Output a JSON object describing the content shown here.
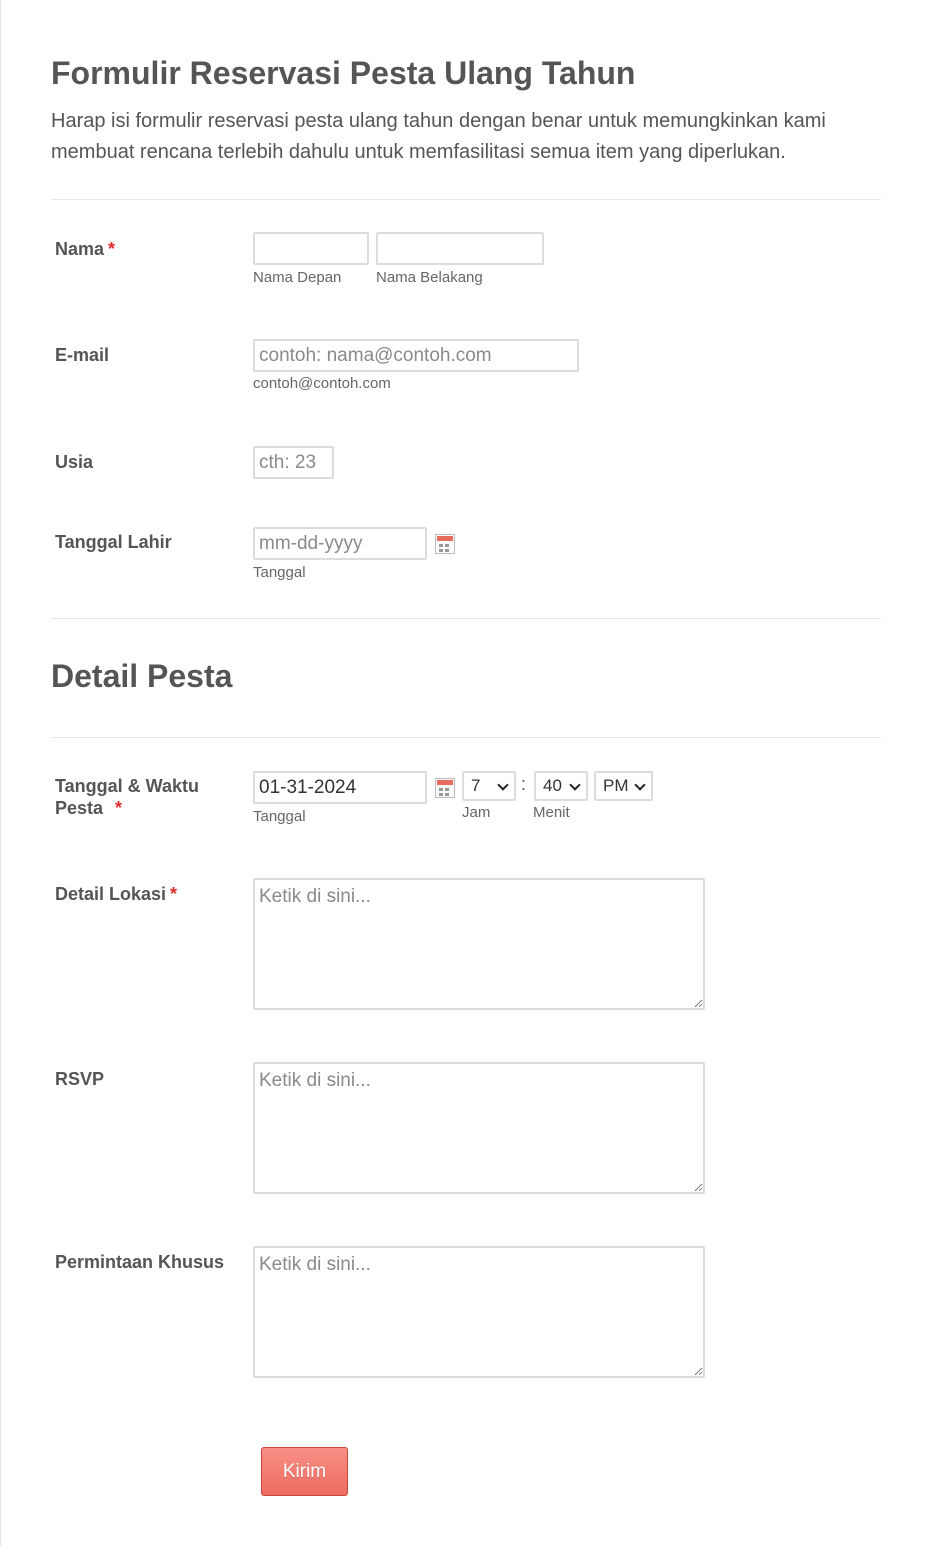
{
  "form": {
    "title": "Formulir Reservasi Pesta Ulang Tahun",
    "subtitle": "Harap isi formulir reservasi pesta ulang tahun dengan benar untuk memungkinkan kami membuat rencana terlebih dahulu untuk memfasilitasi semua item yang diperlukan.",
    "required_mark": "*"
  },
  "fields": {
    "nama": {
      "label": "Nama",
      "first_sublabel": "Nama Depan",
      "last_sublabel": "Nama Belakang",
      "first_value": "",
      "last_value": ""
    },
    "email": {
      "label": "E-mail",
      "placeholder": "contoh: nama@contoh.com",
      "sublabel": "contoh@contoh.com"
    },
    "usia": {
      "label": "Usia",
      "placeholder": "cth: 23"
    },
    "tanggal_lahir": {
      "label": "Tanggal Lahir",
      "placeholder": "mm-dd-yyyy",
      "sublabel": "Tanggal"
    }
  },
  "section": {
    "title": "Detail Pesta"
  },
  "party": {
    "datetime": {
      "label_line1": "Tanggal & Waktu",
      "label_line2": "Pesta",
      "date_value": "01-31-2024",
      "date_sublabel": "Tanggal",
      "hour": "7",
      "hour_sublabel": "Jam",
      "separator": ":",
      "minute": "40",
      "minute_sublabel": "Menit",
      "ampm": "PM"
    },
    "lokasi": {
      "label": "Detail Lokasi",
      "placeholder": "Ketik di sini..."
    },
    "rsvp": {
      "label": "RSVP",
      "placeholder": "Ketik di sini..."
    },
    "khusus": {
      "label": "Permintaan Khusus",
      "placeholder": "Ketik di sini..."
    }
  },
  "submit": {
    "label": "Kirim"
  },
  "colors": {
    "accent": "#ee6b5f",
    "required": "#e02b2b",
    "text": "#555555",
    "border": "#dcdcdc"
  }
}
